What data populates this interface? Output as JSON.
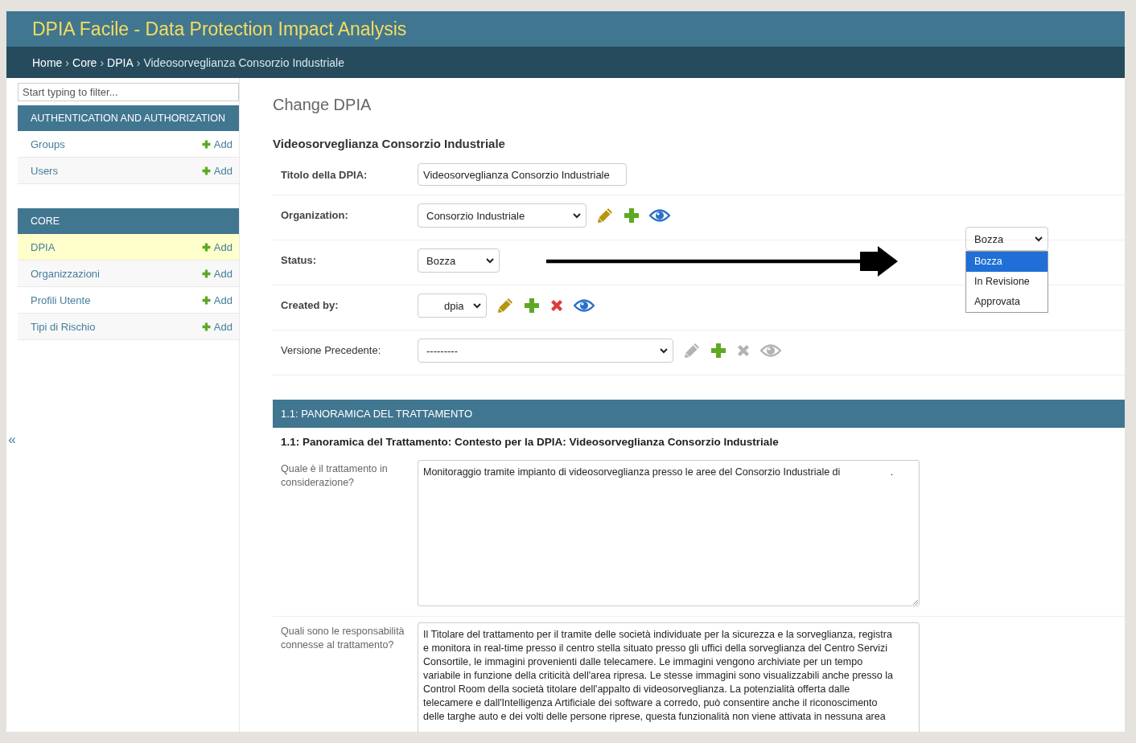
{
  "header": {
    "title": "DPIA Facile - Data Protection Impact Analysis"
  },
  "breadcrumbs": {
    "separator": "›",
    "items": [
      {
        "label": "Home",
        "current": false
      },
      {
        "label": "Core",
        "current": false
      },
      {
        "label": "DPIA",
        "current": false
      },
      {
        "label": "Videosorveglianza Consorzio Industriale",
        "current": true
      }
    ]
  },
  "sidebar": {
    "filter_placeholder": "Start typing to filter...",
    "toggle": "«",
    "modules": [
      {
        "title": "AUTHENTICATION AND AUTHORIZATION",
        "models": [
          {
            "name": "Groups",
            "add": "Add",
            "selected": false
          },
          {
            "name": "Users",
            "add": "Add",
            "selected": false
          }
        ]
      },
      {
        "title": "CORE",
        "models": [
          {
            "name": "DPIA",
            "add": "Add",
            "selected": true
          },
          {
            "name": "Organizzazioni",
            "add": "Add",
            "selected": false
          },
          {
            "name": "Profili Utente",
            "add": "Add",
            "selected": false
          },
          {
            "name": "Tipi di Rischio",
            "add": "Add",
            "selected": false
          }
        ]
      }
    ]
  },
  "form": {
    "title": "Change DPIA",
    "object_title": "Videosorveglianza Consorzio Industriale",
    "fields": [
      {
        "kind": "text",
        "label": "Titolo della DPIA:",
        "required": true,
        "value": "Videosorveglianza Consorzio Industriale"
      },
      {
        "kind": "select",
        "label": "Organization:",
        "required": true,
        "value": "Consorzio Industriale",
        "actions": [
          {
            "kind": "edit",
            "disabled": false
          },
          {
            "kind": "add",
            "disabled": false
          },
          {
            "kind": "view",
            "disabled": false
          }
        ]
      },
      {
        "kind": "select",
        "label": "Status:",
        "required": true,
        "value": "Bozza"
      },
      {
        "kind": "select",
        "label": "Created by:",
        "required": true,
        "value": "dpia",
        "actions": [
          {
            "kind": "edit",
            "disabled": false
          },
          {
            "kind": "add",
            "disabled": false
          },
          {
            "kind": "delete",
            "disabled": false
          },
          {
            "kind": "view",
            "disabled": false
          }
        ]
      },
      {
        "kind": "select",
        "label": "Versione Precedente:",
        "required": false,
        "value": "---------",
        "actions": [
          {
            "kind": "edit",
            "disabled": true
          },
          {
            "kind": "add",
            "disabled": false
          },
          {
            "kind": "delete",
            "disabled": true
          },
          {
            "kind": "view",
            "disabled": true
          }
        ]
      }
    ]
  },
  "section": {
    "title": "1.1: PANORAMICA DEL TRATTAMENTO",
    "description": "1.1: Panoramica del Trattamento: Contesto per la DPIA: Videosorveglianza Consorzio Industriale",
    "fields": [
      {
        "label": "Quale è il trattamento in considerazione?",
        "lines": [
          "Monitoraggio tramite impianto di videosorveglianza presso le aree del Consorzio Industriale di                  ."
        ]
      },
      {
        "label": "Quali sono le responsabilità connesse al trattamento?",
        "lines": [
          "Il Titolare del trattamento per il tramite delle società individuate per la sicurezza e la sorveglianza, registra",
          "e monitora in real-time presso il centro stella situato presso gli uffici della sorveglianza del Centro Servizi",
          "Consortile, le immagini provenienti dalle telecamere. Le immagini vengono archiviate per un tempo",
          "variabile in funzione della criticità dell'area ripresa. Le stesse immagini sono visualizzabili anche presso la",
          "Control Room della società titolare dell'appalto di videosorveglianza. La potenzialità offerta dalle",
          "telecamere e dall'Intelligenza Artificiale dei software a corredo, può consentire anche il riconoscimento",
          "delle targhe auto e dei volti delle persone riprese, questa funzionalità non viene attivata in nessuna area"
        ]
      }
    ]
  },
  "status_dropdown": {
    "value": "Bozza",
    "options": [
      {
        "label": "Bozza",
        "selected": true
      },
      {
        "label": "In Revisione",
        "selected": false
      },
      {
        "label": "Approvata",
        "selected": false
      }
    ]
  }
}
